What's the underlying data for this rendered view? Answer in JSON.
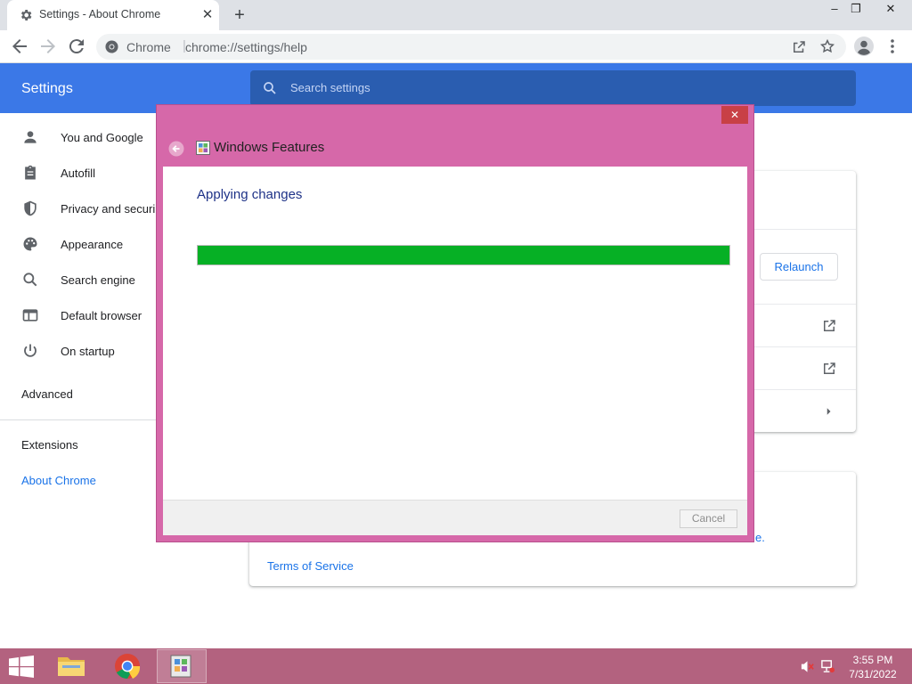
{
  "browser": {
    "tab_title": "Settings - About Chrome",
    "tab_close": "✕",
    "new_tab": "+",
    "window_controls": {
      "minimize": "–",
      "restore": "❐",
      "close": "✕"
    },
    "omnibox_site": "Chrome",
    "omnibox_separator": "|",
    "omnibox_url": "chrome://settings/help"
  },
  "settings": {
    "title": "Settings",
    "search_placeholder": "Search settings",
    "sidebar": {
      "items": [
        {
          "label": "You and Google",
          "icon": "person-icon"
        },
        {
          "label": "Autofill",
          "icon": "clipboard-icon"
        },
        {
          "label": "Privacy and securi",
          "icon": "shield-icon"
        },
        {
          "label": "Appearance",
          "icon": "palette-icon"
        },
        {
          "label": "Search engine",
          "icon": "search-icon"
        },
        {
          "label": "Default browser",
          "icon": "browser-window-icon"
        },
        {
          "label": "On startup",
          "icon": "power-icon"
        }
      ],
      "advanced": "Advanced",
      "extensions": "Extensions",
      "about_chrome": "About Chrome"
    },
    "relaunch_label": "Relaunch",
    "fragment_text": "e.",
    "terms_of_service": "Terms of Service",
    "accent_color": "#1a73e8",
    "header_color": "#3b78e7"
  },
  "dialog": {
    "close": "✕",
    "title": "Windows Features",
    "heading": "Applying changes",
    "progress_percent": 100,
    "progress_color": "#06b025",
    "cancel_label": "Cancel"
  },
  "taskbar": {
    "time": "3:55 PM",
    "date": "7/31/2022",
    "color": "#b3627f"
  }
}
